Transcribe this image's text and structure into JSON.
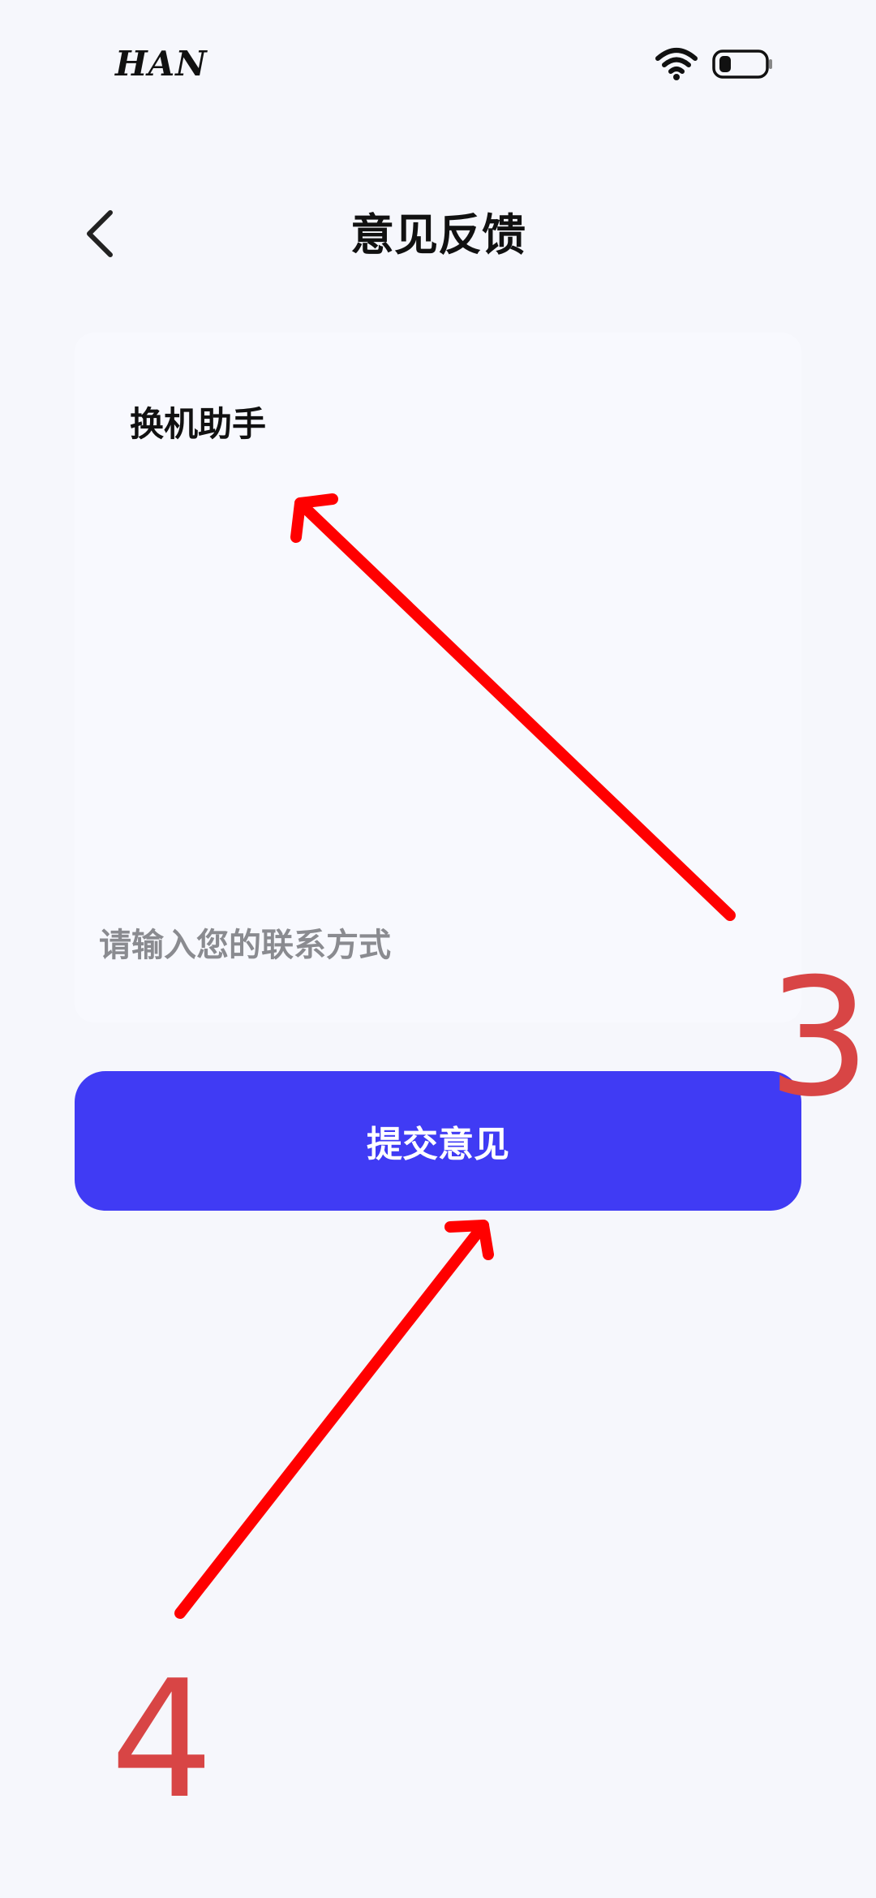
{
  "status_bar": {
    "carrier": "HAN",
    "wifi_icon": "wifi-icon",
    "battery_icon": "battery-low-icon"
  },
  "nav": {
    "back_icon": "chevron-left-icon",
    "title": "意见反馈"
  },
  "form": {
    "feedback_value": "换机助手",
    "contact_placeholder": "请输入您的联系方式",
    "contact_value": ""
  },
  "submit": {
    "label": "提交意见",
    "color": "#403bf4"
  },
  "annotations": {
    "color": "#ff0000",
    "number_color": "#d84545",
    "step_3": "3",
    "step_4": "4"
  }
}
